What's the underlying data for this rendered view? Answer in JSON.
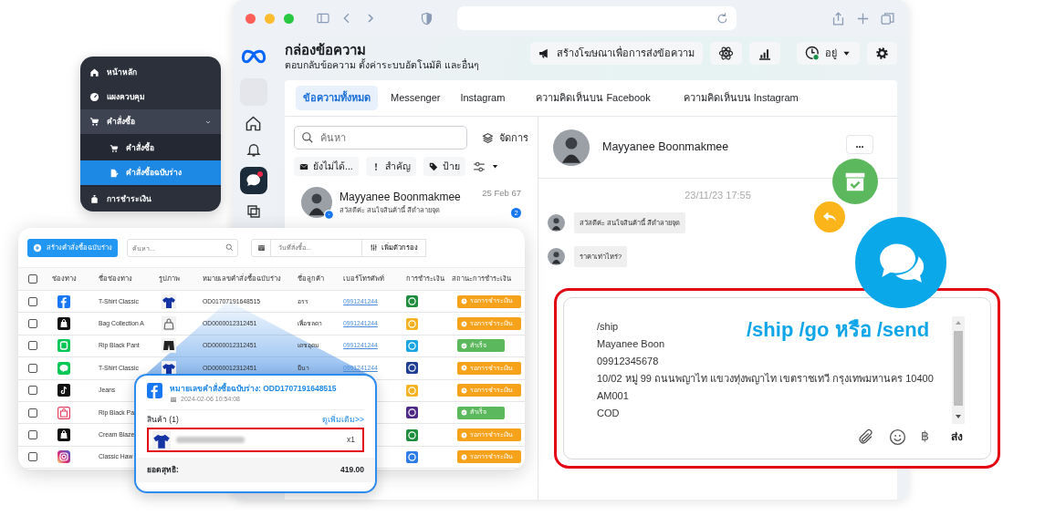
{
  "sidebar_menu": {
    "items": [
      {
        "kind": "home",
        "label": "หน้าหลัก",
        "selected": false
      },
      {
        "kind": "gauge",
        "label": "แผงควบคุม",
        "selected": false
      },
      {
        "kind": "cart",
        "label": "คำสั่งซื้อ",
        "selected": false,
        "expanded": true,
        "children": [
          {
            "kind": "cart",
            "label": "คำสั่งซื้อ",
            "selected": false
          },
          {
            "kind": "draft",
            "label": "คำสั่งซื้อฉบับร่าง",
            "selected": true
          }
        ]
      },
      {
        "kind": "money",
        "label": "การชำระเงิน",
        "selected": false
      }
    ]
  },
  "inbox": {
    "title": "กล่องข้อความ",
    "subtitle": "ตอบกลับข้อความ ตั้งค่าระบบอัตโนมัติ และอื่นๆ",
    "ad_button": "สร้างโฆษณาเพื่อการส่งข้อความ",
    "status_label": "อยู่",
    "tabs": [
      {
        "label": "ข้อความทั้งหมด",
        "selected": true
      },
      {
        "label": "Messenger",
        "selected": false
      },
      {
        "label": "Instagram",
        "selected": false
      },
      {
        "label": "ความคิดเห็นบน Facebook",
        "selected": false
      },
      {
        "label": "ความคิดเห็นบน Instagram",
        "selected": false
      }
    ],
    "search": {
      "placeholder": "ค้นหา"
    },
    "manage_label": "จัดการ",
    "filters": [
      {
        "kind": "unread",
        "label": "ยังไม่ได้..."
      },
      {
        "kind": "important",
        "label": "สำคัญ"
      },
      {
        "kind": "tag",
        "label": "ป้าย"
      }
    ],
    "conversations": [
      {
        "name": "Mayyanee Boonmakmee",
        "date": "25 Feb 67",
        "preview": "สวัสดีค่ะ สนใจสินค้านี้ สีดำลายจุด",
        "unread_count": "2"
      }
    ],
    "chat": {
      "name": "Mayyanee Boonmakmee",
      "more_label": "...",
      "timestamp": "23/11/23 17:55",
      "messages": [
        {
          "text": "สวัสดีค่ะ สนใจสินค้านี้ สีดำลายจุด"
        },
        {
          "text": "ราคาเท่าไหร่?"
        }
      ]
    }
  },
  "composer": {
    "lines": [
      "/ship",
      "Mayanee Boon",
      "09912345678",
      "10/02 หมู่ 99 ถนนพญาไท แขวงทุ่งพญาไท เขตราชเทวี กรุงเทพมหานคร 10400",
      "AM001",
      "COD"
    ],
    "command_hint": "/ship  /go หรือ /send",
    "currency_symbol": "฿",
    "send_label": "ส่ง"
  },
  "orders": {
    "create_button": "สร้างคำสั่งซื้อฉบับร่าง",
    "search": {
      "placeholder": "ค้นหา..."
    },
    "date": {
      "placeholder": "วันที่สั่งซื้อ..."
    },
    "filter_button": "เพิ่มตัวกรอง",
    "select_all": {
      "checked": false
    },
    "columns": [
      "ช่องทาง",
      "ชื่อช่องทาง",
      "รูปภาพ",
      "หมายเลขคำสั่งซื้อฉบับร่าง",
      "ชื่อลูกค้า",
      "เบอร์โทรศัพท์",
      "การชำระเงิน",
      "สถานะการชำระเงิน"
    ],
    "rows": [
      {
        "checked": false,
        "channel": {
          "kind": "facebook",
          "name": "T-Shirt Classic"
        },
        "image": {
          "kind": "tshirt"
        },
        "order_no": "OD01707191648515",
        "customer": "อรร",
        "phone": "0991241244",
        "payment": {
          "color": "#1e8e3e"
        },
        "status": {
          "kind": "pending",
          "label": "รอการชำระเงิน"
        }
      },
      {
        "checked": false,
        "channel": {
          "kind": "shop",
          "name": "Bag Collection A"
        },
        "image": {
          "kind": "bag"
        },
        "order_no": "OD0000012312451",
        "customer": "เพื่อชลดา",
        "phone": "0991241244",
        "payment": {
          "color": "#f5b324"
        },
        "status": {
          "kind": "pending",
          "label": "รอการชำระเงิน"
        }
      },
      {
        "checked": false,
        "channel": {
          "kind": "lineshop",
          "name": "Rip Black Pant"
        },
        "image": {
          "kind": "pants"
        },
        "order_no": "OD0000012312451",
        "customer": "เดชอุดม",
        "phone": "0991241244",
        "payment": {
          "color": "#1ba5e1"
        },
        "status": {
          "kind": "success",
          "label": "สำเร็จ"
        }
      },
      {
        "checked": false,
        "channel": {
          "kind": "line",
          "name": "T-Shirt Classic"
        },
        "image": {
          "kind": "tshirt"
        },
        "order_no": "OD0000012312451",
        "customer": "มีนา",
        "phone": "0991241244",
        "payment": {
          "color": "#1e3f8f"
        },
        "status": {
          "kind": "pending",
          "label": "รอการชำระเงิน"
        }
      },
      {
        "checked": false,
        "channel": {
          "kind": "tiktok",
          "name": "Jeans"
        },
        "payment": {
          "color": "#f5b324"
        },
        "status": {
          "kind": "pending",
          "label": "รอการชำระเงิน"
        }
      },
      {
        "checked": false,
        "channel": {
          "kind": "pinkshop",
          "name": "Rip Black Pa"
        },
        "payment": {
          "color": "#4e2a84"
        },
        "status": {
          "kind": "success",
          "label": "สำเร็จ"
        }
      },
      {
        "checked": false,
        "channel": {
          "kind": "shop",
          "name": "Cream Blaze"
        },
        "payment": {
          "color": "#1e8e3e"
        },
        "status": {
          "kind": "pending",
          "label": "รอการชำระเงิน"
        }
      },
      {
        "checked": false,
        "channel": {
          "kind": "instagram",
          "name": "Classic Haw"
        },
        "payment": {
          "color": "#2d7be5"
        },
        "status": {
          "kind": "pending",
          "label": "รอการชำระเงิน"
        }
      }
    ]
  },
  "order_popup": {
    "title": "หมายเลขคำสั่งซื้อฉบับร่าง: ODD1707191648515",
    "datetime": "2024-02-06 10:54:08",
    "items_label": "สินค้า (1)",
    "more_link": "ดูเพิ่มเติม>>",
    "item_qty": "x1",
    "total_label": "ยอดสุทธิ:",
    "total": "419.00"
  }
}
